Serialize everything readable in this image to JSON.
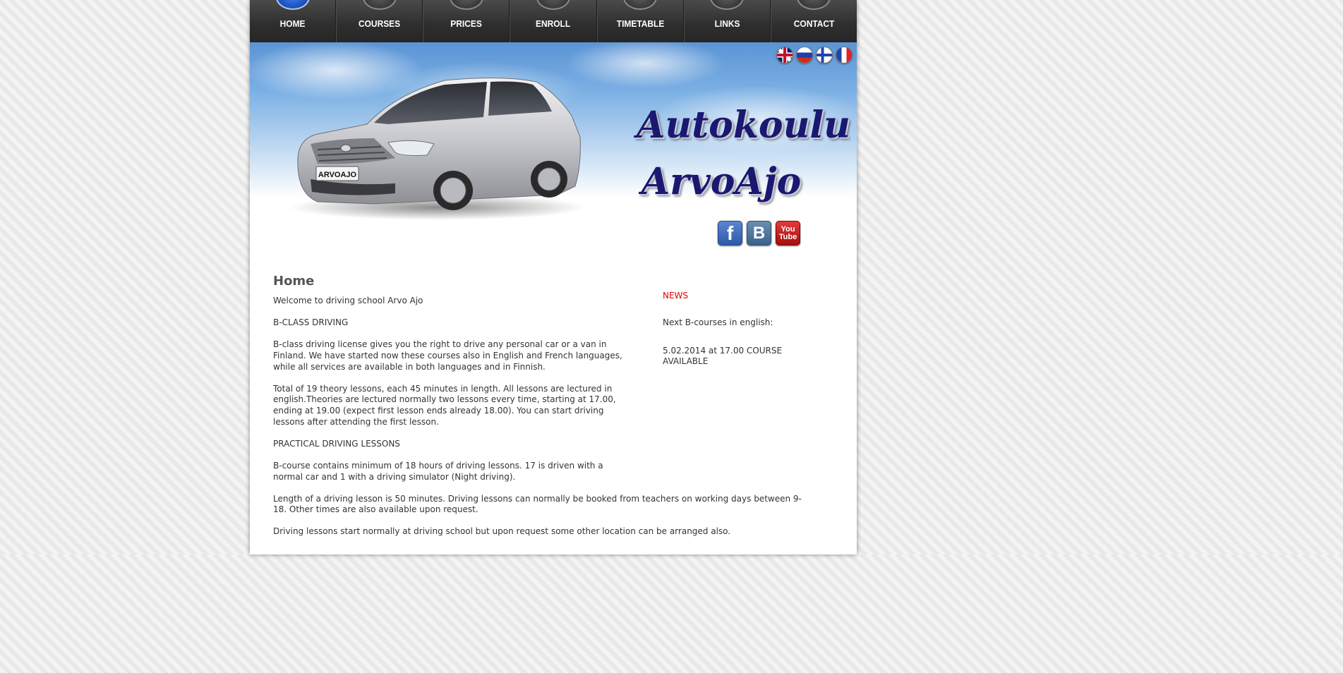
{
  "nav": {
    "items": [
      {
        "label": "HOME"
      },
      {
        "label": "COURSES"
      },
      {
        "label": "PRICES"
      },
      {
        "label": "ENROLL"
      },
      {
        "label": "TIMETABLE"
      },
      {
        "label": "LINKS"
      },
      {
        "label": "CONTACT"
      }
    ],
    "active": "HOME"
  },
  "header": {
    "logo_line1": "Autokoulu",
    "logo_line2": "ArvoAjo",
    "plate": "ARVOAJO",
    "languages": [
      "english-flag-icon",
      "russian-flag-icon",
      "finnish-flag-icon",
      "french-flag-icon"
    ],
    "social": {
      "facebook": "f",
      "vk": "B",
      "youtube_line1": "You",
      "youtube_line2": "Tube"
    }
  },
  "main": {
    "title": "Home",
    "paragraphs": [
      "Welcome to driving school Arvo Ajo",
      "B-CLASS DRIVING",
      "B-class driving license gives you the right to drive any personal car or a van in Finland. We have started now these courses also in English and French languages, while all services are available in both languages and in Finnish.",
      "Total of 19 theory lessons, each 45 minutes in length. All lessons are lectured in english.Theories are lectured normally two lessons every time, starting at 17.00, ending at 19.00 (expect first lesson ends already 18.00). You can start driving lessons after attending the first lesson.",
      "PRACTICAL DRIVING LESSONS",
      "B-course contains minimum of 18 hours of driving lessons. 17 is driven with a normal car and 1 with a driving simulator (Night driving).",
      "Length of a driving lesson is 50 minutes. Driving lessons can normally be booked from teachers on working days between 9-18. Other times are also available upon request.",
      "Driving lessons start normally at driving school but upon request some other location can be arranged also."
    ]
  },
  "news": {
    "title": "NEWS",
    "items": [
      "Next B-courses in english:",
      "5.02.2014 at 17.00 COURSE AVAILABLE"
    ]
  },
  "colors": {
    "nav_bg": "#2e2e2e",
    "news_title": "#e00000",
    "logo": "#1a1870"
  }
}
